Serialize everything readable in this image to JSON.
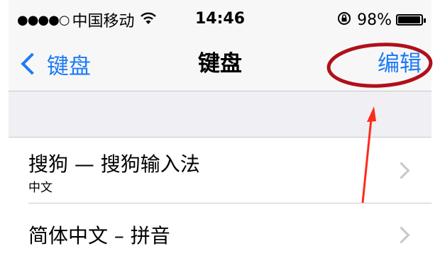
{
  "status_bar": {
    "signal": "●●●●○",
    "carrier": "中国移动",
    "time": "14:46",
    "battery_percent": "98%",
    "battery_level": 0.98,
    "icons": [
      "signal-dots-icon",
      "wifi-icon",
      "orientation-lock-icon",
      "battery-icon"
    ]
  },
  "nav": {
    "back_label": "键盘",
    "title": "键盘",
    "edit_label": "编辑"
  },
  "list": {
    "items": [
      {
        "title": "搜狗 — 搜狗输入法",
        "subtitle": "中文"
      },
      {
        "title": "简体中文 – 拼音"
      }
    ]
  },
  "colors": {
    "ios_blue": "#1e7cf5",
    "annotation_red": "#b0101a",
    "arrow_red": "#ff2a1a",
    "background": "#efeff4"
  }
}
